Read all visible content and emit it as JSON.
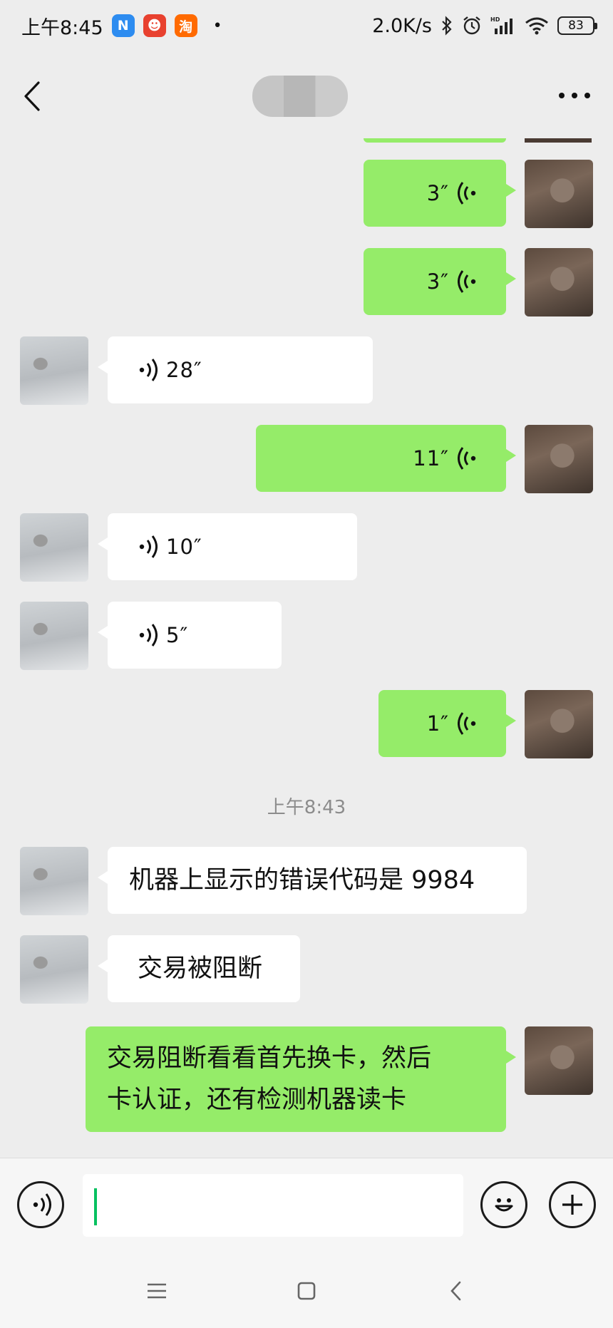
{
  "status_bar": {
    "time": "上午8:45",
    "apps": [
      {
        "icon": "n-app-icon",
        "glyph": "N",
        "color": "#2d8cf0"
      },
      {
        "icon": "mascot-app-icon",
        "glyph": "☻",
        "color": "#e8412f"
      },
      {
        "icon": "taobao-app-icon",
        "glyph": "淘",
        "color": "#ff6a00"
      }
    ],
    "dot": "•",
    "net_speed": "2.0K/s",
    "battery": "83"
  },
  "messages": [
    {
      "side": "me",
      "type": "voice",
      "duration": "3″"
    },
    {
      "side": "me",
      "type": "voice",
      "duration": "3″"
    },
    {
      "side": "other",
      "type": "voice",
      "duration": "28″"
    },
    {
      "side": "me",
      "type": "voice",
      "duration": "11″"
    },
    {
      "side": "other",
      "type": "voice",
      "duration": "10″"
    },
    {
      "side": "other",
      "type": "voice",
      "duration": "5″"
    },
    {
      "side": "me",
      "type": "voice",
      "duration": "1″"
    },
    {
      "side": "other",
      "type": "text",
      "text": "机器上显示的错误代码是 9984"
    },
    {
      "side": "other",
      "type": "text",
      "text": "交易被阻断"
    },
    {
      "side": "me",
      "type": "text",
      "lines": [
        "交易阻断看看首先换卡，然后",
        "卡认证，还有检测机器读卡"
      ]
    }
  ],
  "timestamp": "上午8:43",
  "input": {
    "value": ""
  },
  "colors": {
    "accent_green": "#95ec69",
    "cursor": "#07c160",
    "background": "#ededed"
  }
}
